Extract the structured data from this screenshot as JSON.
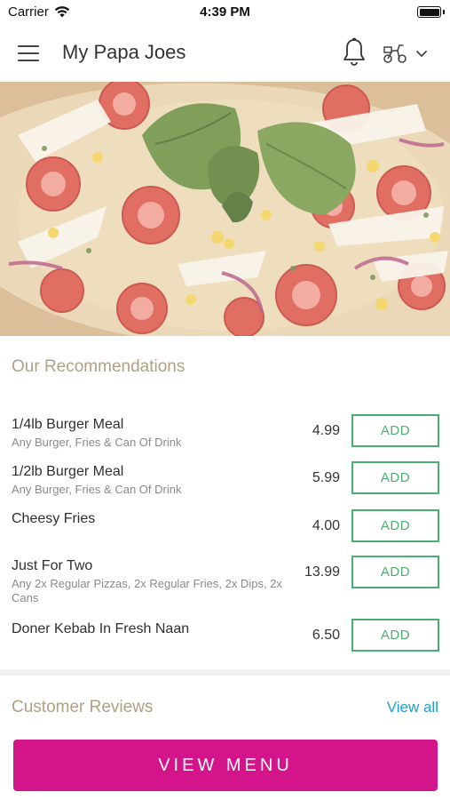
{
  "status_bar": {
    "carrier": "Carrier",
    "time": "4:39 PM"
  },
  "header": {
    "title": "My Papa Joes",
    "icons": [
      "menu-icon",
      "bell-icon",
      "scooter-icon",
      "chevron-down-icon"
    ]
  },
  "hero": {
    "image": "pizza-photo"
  },
  "recommendations": {
    "title": "Our Recommendations",
    "add_label": "ADD",
    "items": [
      {
        "name": "1/4lb Burger Meal",
        "description": "Any Burger, Fries & Can Of Drink",
        "price": "4.99"
      },
      {
        "name": "1/2lb Burger Meal",
        "description": "Any Burger, Fries & Can Of Drink",
        "price": "5.99"
      },
      {
        "name": "Cheesy Fries",
        "description": "",
        "price": "4.00"
      },
      {
        "name": "Just For Two",
        "description": "Any 2x Regular Pizzas, 2x Regular Fries, 2x Dips, 2x Cans",
        "price": "13.99"
      },
      {
        "name": "Doner Kebab In Fresh Naan",
        "description": "",
        "price": "6.50"
      }
    ]
  },
  "reviews": {
    "title": "Customer Reviews",
    "view_all": "View all"
  },
  "cta": {
    "label": "VIEW MENU"
  },
  "colors": {
    "brand_pink": "#d4148a",
    "add_green": "#4caf72",
    "section_title": "#b1a083",
    "link_blue": "#1e9ec9"
  }
}
